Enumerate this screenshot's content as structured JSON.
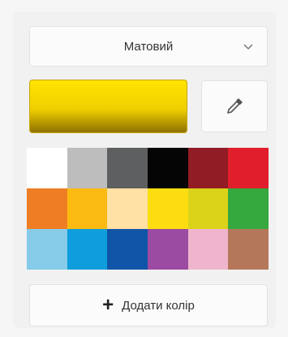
{
  "finish_dropdown": {
    "selected": "Матовий"
  },
  "current_color": {
    "gradient_top": "#ffe400",
    "gradient_mid": "#f0cf00",
    "gradient_bottom": "#8e7200"
  },
  "eyedropper": {
    "icon": "eyedropper-icon"
  },
  "palette": {
    "rows": [
      [
        "#ffffff",
        "#bdbdbd",
        "#5d5f60",
        "#050505",
        "#921c25",
        "#e11e2c"
      ],
      [
        "#ee7d24",
        "#fbba12",
        "#ffe0a5",
        "#fbdd10",
        "#dad31a",
        "#35a83e"
      ],
      [
        "#86cbe8",
        "#109ddd",
        "#1155a8",
        "#9c4ba2",
        "#efb5cc",
        "#b4775a"
      ]
    ]
  },
  "add_color_button": {
    "icon": "plus-icon",
    "label": "Додати колір"
  }
}
